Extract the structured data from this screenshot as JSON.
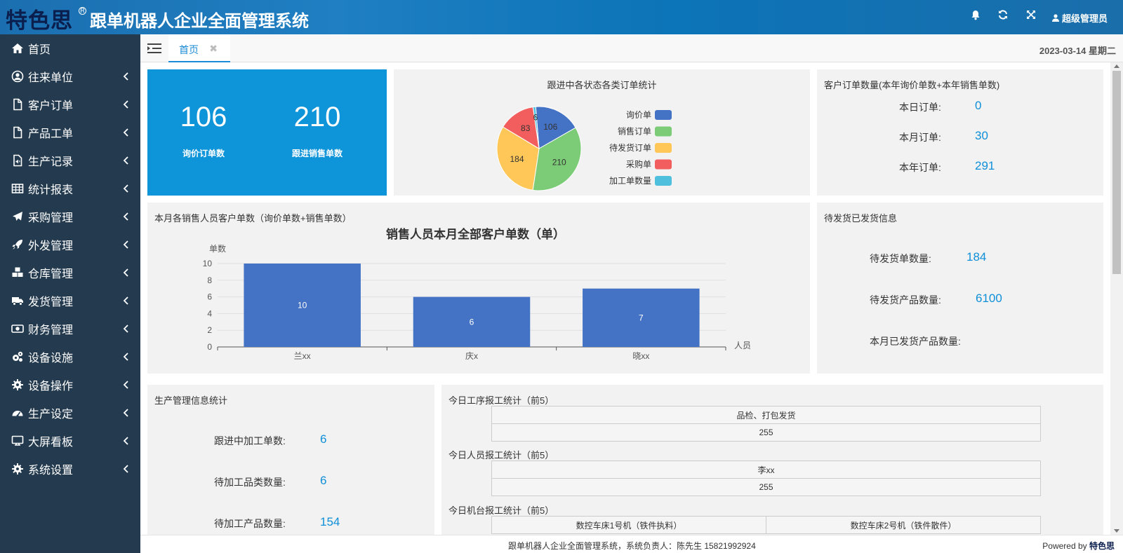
{
  "header": {
    "brand": "特色思",
    "brand_mark": "R",
    "title": "跟单机器人企业全面管理系统",
    "user": "超级管理员"
  },
  "sidebar": {
    "items": [
      {
        "label": "首页",
        "icon": "home-icon",
        "has_children": false
      },
      {
        "label": "往来单位",
        "icon": "user-circle-icon",
        "has_children": true
      },
      {
        "label": "客户订单",
        "icon": "file-icon",
        "has_children": true
      },
      {
        "label": "产品工单",
        "icon": "file-icon",
        "has_children": true
      },
      {
        "label": "生产记录",
        "icon": "file-audio-icon",
        "has_children": true
      },
      {
        "label": "统计报表",
        "icon": "table-icon",
        "has_children": true
      },
      {
        "label": "采购管理",
        "icon": "plane-icon",
        "has_children": true
      },
      {
        "label": "外发管理",
        "icon": "rocket-icon",
        "has_children": true
      },
      {
        "label": "仓库管理",
        "icon": "cubes-icon",
        "has_children": true
      },
      {
        "label": "发货管理",
        "icon": "truck-icon",
        "has_children": true
      },
      {
        "label": "财务管理",
        "icon": "money-icon",
        "has_children": true
      },
      {
        "label": "设备设施",
        "icon": "cogs-icon",
        "has_children": true
      },
      {
        "label": "设备操作",
        "icon": "gear-icon",
        "has_children": true
      },
      {
        "label": "生产设定",
        "icon": "dashboard-icon",
        "has_children": true
      },
      {
        "label": "大屏看板",
        "icon": "desktop-icon",
        "has_children": true
      },
      {
        "label": "系统设置",
        "icon": "gear-icon",
        "has_children": true
      }
    ]
  },
  "tabs": {
    "home_label": "首页",
    "date": "2023-03-14 星期二"
  },
  "summary": {
    "inquiry_count": "106",
    "inquiry_label": "询价订单数",
    "sales_count": "210",
    "sales_label": "跟进销售单数"
  },
  "customer_orders": {
    "title": "客户订单数量(本年询价单数+本年销售单数)",
    "rows": [
      {
        "label": "本日订单:",
        "value": "0"
      },
      {
        "label": "本月订单:",
        "value": "30"
      },
      {
        "label": "本年订单:",
        "value": "291"
      }
    ]
  },
  "shipping": {
    "title": "待发货已发货信息",
    "rows": [
      {
        "label": "待发货单数量:",
        "value": "184"
      },
      {
        "label": "待发货产品数量:",
        "value": "6100"
      },
      {
        "label": "本月已发货产品数量:",
        "value": ""
      }
    ]
  },
  "production": {
    "title": "生产管理信息统计",
    "rows": [
      {
        "label": "跟进中加工单数:",
        "value": "6"
      },
      {
        "label": "待加工品类数量:",
        "value": "6"
      },
      {
        "label": "待加工产品数量:",
        "value": "154"
      }
    ]
  },
  "reports": {
    "process_title": "今日工序报工统计（前5）",
    "process_header": "品检、打包发货",
    "process_value": "255",
    "person_title": "今日人员报工统计（前5）",
    "person_header": "李xx",
    "person_value": "255",
    "machine_title": "今日机台报工统计（前5）",
    "machine_header_1": "数控车床1号机（铁件执料）",
    "machine_header_2": "数控车床2号机（铁件散件）"
  },
  "footer": {
    "text": "跟单机器人企业全面管理系统，系统负责人：陈先生 15821992924",
    "powered_label": "Powered by",
    "powered_brand": "特色思"
  },
  "chart_data": [
    {
      "type": "pie",
      "title": "跟进中各状态各类订单统计",
      "labels": [
        "询价单",
        "销售订单",
        "待发货订单",
        "采购单",
        "加工单数量"
      ],
      "values": [
        106,
        210,
        184,
        83,
        6
      ],
      "colors": [
        "#4472c4",
        "#7bcb77",
        "#ffc658",
        "#f25e5e",
        "#4ec0dd"
      ],
      "legend": "right"
    },
    {
      "type": "bar",
      "panel_title": "本月各销售人员客户单数（询价单数+销售单数）",
      "title": "销售人员本月全部客户单数（单）",
      "categories": [
        "兰xx",
        "庆x",
        "晓xx"
      ],
      "values": [
        10,
        6,
        7
      ],
      "ylabel": "单数",
      "xlabel": "人员",
      "ylim": [
        0,
        10
      ],
      "yticks": [
        0,
        2,
        4,
        6,
        8,
        10
      ],
      "color": "#4472c4",
      "grid": true
    }
  ]
}
